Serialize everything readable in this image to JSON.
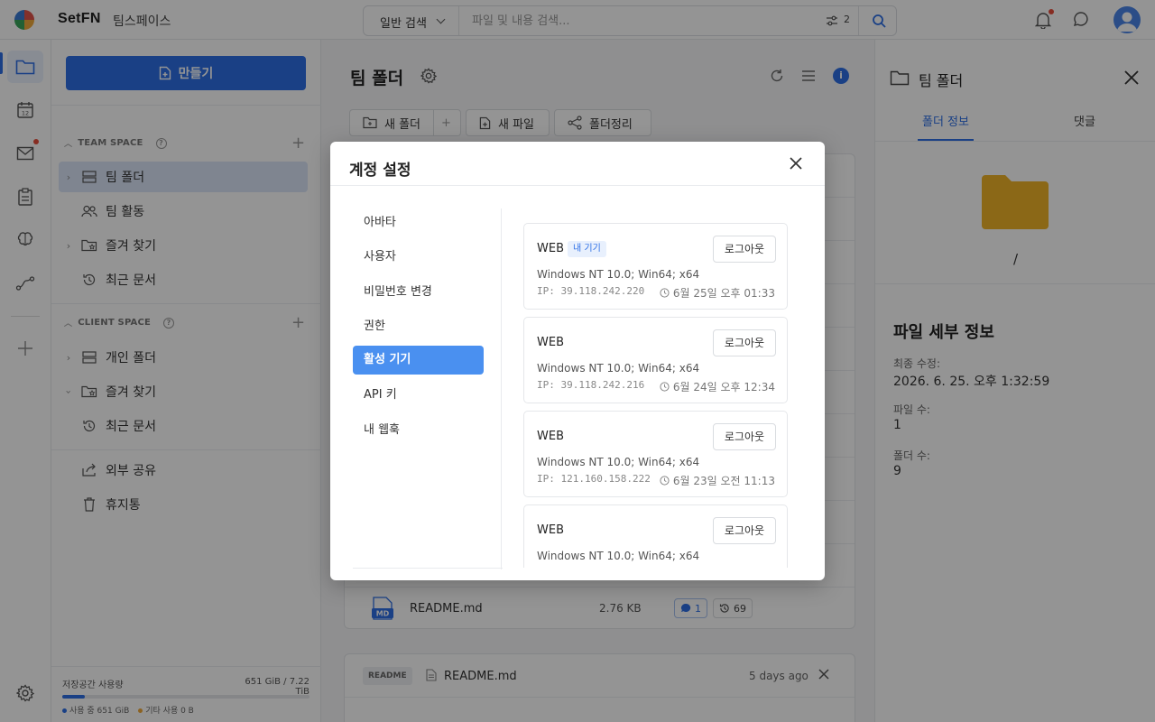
{
  "app": {
    "brand": "SetFN",
    "workspace": "팀스페이스"
  },
  "search": {
    "mode": "일반 검색",
    "placeholder": "파일 및 내용 검색...",
    "filter_count": "2"
  },
  "sidebar": {
    "create_label": "만들기",
    "team_space_label": "TEAM SPACE",
    "client_space_label": "CLIENT SPACE",
    "team_items": [
      {
        "label": "팀 폴더"
      },
      {
        "label": "팀 활동"
      },
      {
        "label": "즐겨 찾기"
      },
      {
        "label": "최근 문서"
      }
    ],
    "client_items": [
      {
        "label": "개인 폴더"
      },
      {
        "label": "즐겨 찾기"
      },
      {
        "label": "최근 문서"
      }
    ],
    "extra_items": [
      {
        "label": "외부 공유"
      },
      {
        "label": "휴지통"
      }
    ],
    "storage": {
      "label": "저장공간 사용량",
      "value": "651 GiB / 7.22 TiB",
      "used_fraction": 0.09,
      "used_legend": "사용 중 651 GiB",
      "other_legend": "기타 사용 0 B",
      "used_color": "#2d6fe6",
      "other_color": "#f0a93b"
    }
  },
  "main": {
    "title": "팀 폴더",
    "toolbar": {
      "new_folder": "새 폴더",
      "new_file": "새 파일",
      "organize": "폴더정리"
    },
    "file": {
      "name": "README.md",
      "size": "2.76 KB",
      "comments": "1",
      "history": "69",
      "icon_label": "MD"
    },
    "readme": {
      "tag": "README",
      "name": "README.md",
      "time": "5 days ago"
    }
  },
  "right_panel": {
    "title": "팀 폴더",
    "tabs": [
      "폴더 정보",
      "댓글"
    ],
    "path": "/",
    "details_title": "파일 세부 정보",
    "modified_label": "최종 수정:",
    "modified_value": "2026. 6. 25. 오후 1:32:59",
    "file_count_label": "파일 수:",
    "file_count_value": "1",
    "folder_count_label": "폴더 수:",
    "folder_count_value": "9"
  },
  "modal": {
    "title": "계정 설정",
    "menu": [
      "아바타",
      "사용자",
      "비밀번호 변경",
      "권한",
      "활성 기기",
      "API 키",
      "내 웹훅"
    ],
    "active_menu": "활성 기기",
    "logout_label": "로그아웃",
    "devices": [
      {
        "type": "WEB",
        "badge": "내 기기",
        "os": "Windows NT 10.0; Win64; x64",
        "ip": "IP: 39.118.242.220",
        "time": "6월 25일 오후 01:33"
      },
      {
        "type": "WEB",
        "badge": "",
        "os": "Windows NT 10.0; Win64; x64",
        "ip": "IP: 39.118.242.216",
        "time": "6월 24일 오후 12:34"
      },
      {
        "type": "WEB",
        "badge": "",
        "os": "Windows NT 10.0; Win64; x64",
        "ip": "IP: 121.160.158.222",
        "time": "6월 23일 오전 11:13"
      },
      {
        "type": "WEB",
        "badge": "",
        "os": "Windows NT 10.0; Win64; x64",
        "ip": "",
        "time": ""
      }
    ]
  },
  "colors": {
    "accent": "#2d6fe6",
    "menu_active": "#4a90f0",
    "folder": "#f0b429",
    "notification": "#e74c3c"
  }
}
